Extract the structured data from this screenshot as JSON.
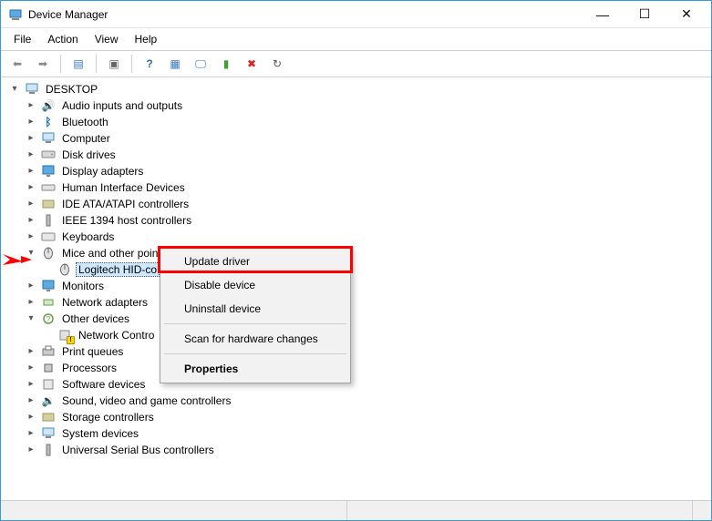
{
  "window": {
    "title": "Device Manager",
    "controls": {
      "min": "—",
      "max": "☐",
      "close": "✕"
    }
  },
  "menubar": [
    "File",
    "Action",
    "View",
    "Help"
  ],
  "toolbar": [
    {
      "name": "back-icon",
      "glyph": "⬅"
    },
    {
      "name": "forward-icon",
      "glyph": "➡"
    },
    {
      "name": "sep"
    },
    {
      "name": "show-hide-tree-icon",
      "glyph": "▤"
    },
    {
      "name": "sep"
    },
    {
      "name": "properties-icon",
      "glyph": "▣"
    },
    {
      "name": "sep"
    },
    {
      "name": "help-icon",
      "glyph": "?"
    },
    {
      "name": "action-center-icon",
      "glyph": "▦"
    },
    {
      "name": "scan-icon",
      "glyph": "🖵"
    },
    {
      "name": "add-legacy-icon",
      "glyph": "▮"
    },
    {
      "name": "remove-icon",
      "glyph": "✖"
    },
    {
      "name": "update-icon",
      "glyph": "↻"
    }
  ],
  "tree": {
    "root": {
      "label": "DESKTOP",
      "expanded": true,
      "icon": "computer"
    },
    "items": [
      {
        "label": "Audio inputs and outputs",
        "icon": "audio"
      },
      {
        "label": "Bluetooth",
        "icon": "bluetooth"
      },
      {
        "label": "Computer",
        "icon": "computer"
      },
      {
        "label": "Disk drives",
        "icon": "disk"
      },
      {
        "label": "Display adapters",
        "icon": "display"
      },
      {
        "label": "Human Interface Devices",
        "icon": "hid"
      },
      {
        "label": "IDE ATA/ATAPI controllers",
        "icon": "ide"
      },
      {
        "label": "IEEE 1394 host controllers",
        "icon": "ieee"
      },
      {
        "label": "Keyboards",
        "icon": "keyboard"
      },
      {
        "label": "Mice and other pointing devices",
        "icon": "mouse",
        "expanded": true,
        "children": [
          {
            "label": "Logitech HID-co",
            "icon": "mouse",
            "selected": true
          }
        ]
      },
      {
        "label": "Monitors",
        "icon": "monitor"
      },
      {
        "label": "Network adapters",
        "icon": "network"
      },
      {
        "label": "Other devices",
        "icon": "other",
        "expanded": true,
        "children": [
          {
            "label": "Network Contro",
            "icon": "unknown-warn"
          }
        ]
      },
      {
        "label": "Print queues",
        "icon": "printer"
      },
      {
        "label": "Processors",
        "icon": "cpu"
      },
      {
        "label": "Software devices",
        "icon": "software"
      },
      {
        "label": "Sound, video and game controllers",
        "icon": "sound"
      },
      {
        "label": "Storage controllers",
        "icon": "storage"
      },
      {
        "label": "System devices",
        "icon": "system"
      },
      {
        "label": "Universal Serial Bus controllers",
        "icon": "usb"
      }
    ]
  },
  "context_menu": {
    "items": [
      {
        "label": "Update driver",
        "highlight": true
      },
      {
        "label": "Disable device"
      },
      {
        "label": "Uninstall device"
      },
      {
        "sep": true
      },
      {
        "label": "Scan for hardware changes"
      },
      {
        "sep": true
      },
      {
        "label": "Properties",
        "bold": true
      }
    ]
  }
}
